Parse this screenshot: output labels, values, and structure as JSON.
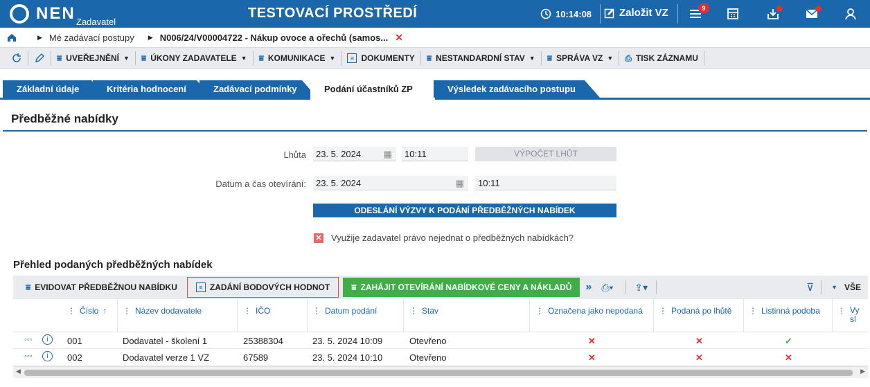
{
  "header": {
    "logo_text": "NEN",
    "logo_sub": "Zadavatel",
    "env_title": "TESTOVACÍ PROSTŘEDÍ",
    "clock": "10:14:08",
    "zalozit_label": "Založit VZ",
    "notification_count": "9",
    "brand_color": "#1b67ab"
  },
  "breadcrumb": {
    "item1": "Mé zadávací postupy",
    "item2": "N006/24/V00004722 - Nákup ovoce a ořechů (samos..."
  },
  "toolbar": {
    "uverejneni": "UVEŘEJNĚNÍ",
    "ukony": "ÚKONY ZADAVATELE",
    "komunikace": "KOMUNIKACE",
    "dokumenty": "DOKUMENTY",
    "nestandardni": "NESTANDARDNÍ STAV",
    "sprava": "SPRÁVA VZ",
    "tisk": "TISK ZÁZNAMU"
  },
  "tabs": [
    "Základní údaje",
    "Kritéria hodnocení",
    "Zadávací podmínky",
    "Podání účastníků ZP",
    "Výsledek zadávacího postupu"
  ],
  "section": {
    "title": "Předběžné nabídky",
    "lhuta_label": "Lhůta",
    "lhuta_date": "23. 5. 2024",
    "lhuta_time": "10:11",
    "vypocet_label": "VÝPOČET LHŮT",
    "otevirani_label": "Datum a čas otevírání:",
    "otevirani_date": "23. 5. 2024",
    "otevirani_time": "10:11",
    "odeslani_label": "ODESLÁNÍ VÝZVY K PODÁNÍ PŘEDBĚŽNÝCH NABÍDEK",
    "checkbox_label": "Využije zadavatel právo nejednat o předběžných nabídkách?"
  },
  "grid": {
    "title": "Přehled podaných předběžných nabídek",
    "btn_evidovat": "EVIDOVAT PŘEDBĚŽNOU NABÍDKU",
    "btn_zadani": "ZADÁNÍ BODOVÝCH HODNOT",
    "btn_zahajit": "ZAHÁJIT OTEVÍRÁNÍ NABÍDKOVÉ CENY A NÁKLADŮ",
    "filter_all": "VŠE",
    "columns": {
      "cislo": "Číslo",
      "nazev": "Název dodavatele",
      "ico": "IČO",
      "datum": "Datum podání",
      "stav": "Stav",
      "oznacena": "Označena jako nepodaná",
      "podana": "Podaná po lhůtě",
      "listinna": "Listinná podoba",
      "last": "Vy sl"
    },
    "rows": [
      {
        "cislo": "001",
        "nazev": "Dodavatel - školení 1",
        "ico": "25388304",
        "datum": "23. 5. 2024 10:09",
        "stav": "Otevřeno",
        "oznacena": "✕",
        "podana": "✕",
        "listinna": "✓"
      },
      {
        "cislo": "002",
        "nazev": "Dodavatel verze 1 VZ",
        "ico": "67589",
        "datum": "23. 5. 2024 10:10",
        "stav": "Otevřeno",
        "oznacena": "✕",
        "podana": "✕",
        "listinna": "✕"
      }
    ]
  }
}
